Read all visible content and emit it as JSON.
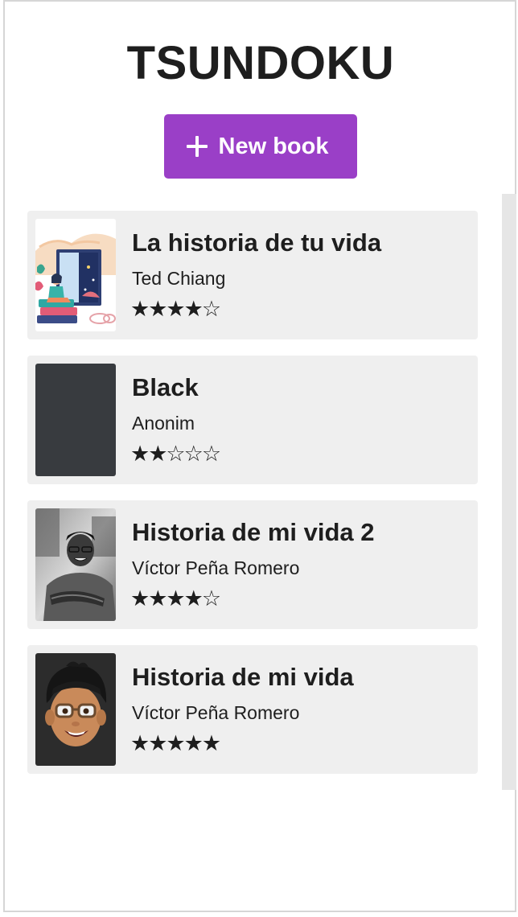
{
  "app": {
    "title": "TSUNDOKU",
    "new_book_label": "New book",
    "new_book_icon": "plus-icon",
    "accent_color": "#9a3fc7"
  },
  "books": [
    {
      "title": "La historia de tu vida",
      "author": "Ted Chiang",
      "rating": 4,
      "rating_display": "★★★★☆",
      "cover": "illustration-reading-girl"
    },
    {
      "title": "Black",
      "author": "Anonim",
      "rating": 2,
      "rating_display": "★★☆☆☆",
      "cover": "solid-dark-gray",
      "cover_color": "#383b3f"
    },
    {
      "title": "Historia de mi vida 2",
      "author": "Víctor Peña Romero",
      "rating": 4,
      "rating_display": "★★★★☆",
      "cover": "bw-photo-man-crossed-arms"
    },
    {
      "title": "Historia de mi vida",
      "author": "Víctor Peña Romero",
      "rating": 5,
      "rating_display": "★★★★★",
      "cover": "memoji-avatar"
    }
  ]
}
